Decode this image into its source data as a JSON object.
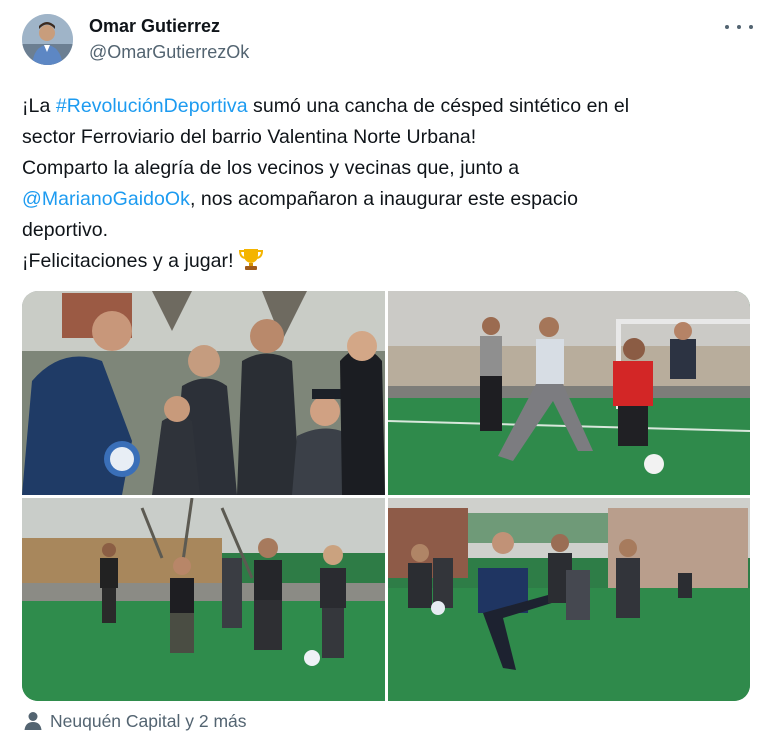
{
  "author": {
    "name": "Omar Gutierrez",
    "handle": "@OmarGutierrezOk"
  },
  "menu_icon": "more-horizontal-icon",
  "tweet": {
    "line1": {
      "pre": "¡La ",
      "hashtag": "#RevoluciónDeportiva",
      "post": " sumó una cancha de césped sintético en el"
    },
    "line2": "sector Ferroviario del barrio Valentina Norte Urbana!",
    "line3": "Comparto la alegría de los vecinos y vecinas que, junto a",
    "line4": {
      "mention": "@MarianoGaidoOk",
      "post": ", nos acompañaron a inaugurar este espacio"
    },
    "line5": "deportivo.",
    "line6": "¡Felicitaciones y a jugar!",
    "emoji": "trophy-icon"
  },
  "media": {
    "photos": [
      "photo-1",
      "photo-2",
      "photo-3",
      "photo-4"
    ]
  },
  "location": {
    "icon": "person-icon",
    "text": "Neuquén Capital y 2 más"
  },
  "colors": {
    "link": "#1d9bf0",
    "secondary_text": "#536471",
    "primary_text": "#0f1419"
  }
}
